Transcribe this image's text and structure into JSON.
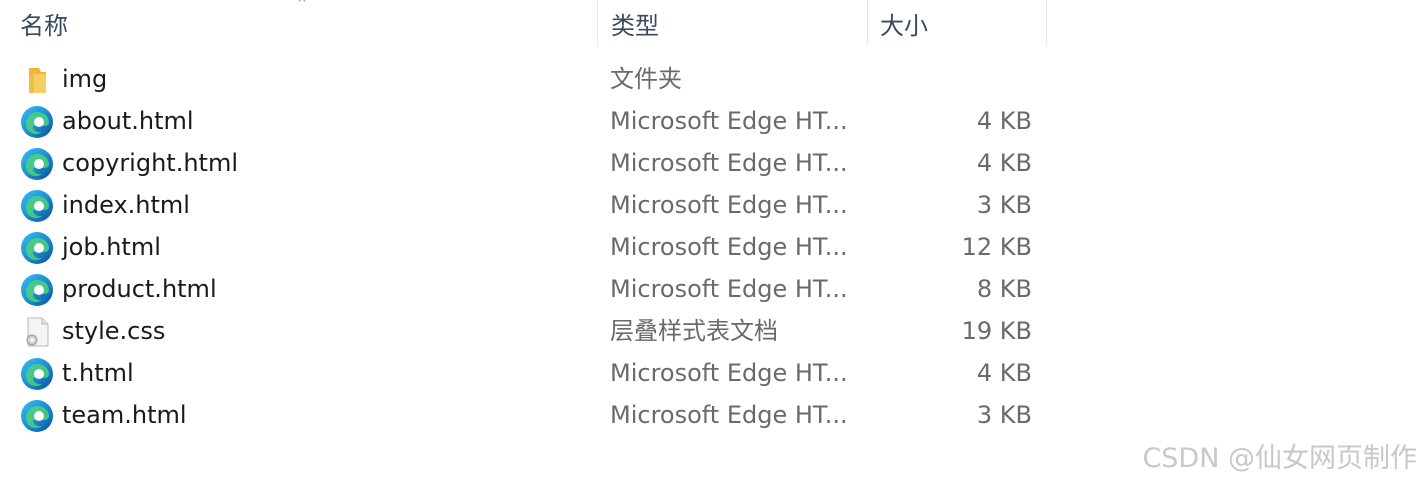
{
  "header": {
    "name_label": "名称",
    "type_label": "类型",
    "size_label": "大小",
    "sort_indicator": "^"
  },
  "files": [
    {
      "name": "img",
      "type": "文件夹",
      "size": "",
      "icon": "folder-icon"
    },
    {
      "name": "about.html",
      "type": "Microsoft Edge HT...",
      "size": "4 KB",
      "icon": "edge-icon"
    },
    {
      "name": "copyright.html",
      "type": "Microsoft Edge HT...",
      "size": "4 KB",
      "icon": "edge-icon"
    },
    {
      "name": "index.html",
      "type": "Microsoft Edge HT...",
      "size": "3 KB",
      "icon": "edge-icon"
    },
    {
      "name": "job.html",
      "type": "Microsoft Edge HT...",
      "size": "12 KB",
      "icon": "edge-icon"
    },
    {
      "name": "product.html",
      "type": "Microsoft Edge HT...",
      "size": "8 KB",
      "icon": "edge-icon"
    },
    {
      "name": "style.css",
      "type": "层叠样式表文档",
      "size": "19 KB",
      "icon": "css-file-icon"
    },
    {
      "name": "t.html",
      "type": "Microsoft Edge HT...",
      "size": "4 KB",
      "icon": "edge-icon"
    },
    {
      "name": "team.html",
      "type": "Microsoft Edge HT...",
      "size": "3 KB",
      "icon": "edge-icon"
    }
  ],
  "watermark": "CSDN @仙女网页制作",
  "colors": {
    "header_text": "#3b4a5e",
    "secondary_text": "#6a6a6a",
    "folder": "#f8c74a",
    "edge_blue": "#0c59a4",
    "edge_green": "#4fd07a"
  }
}
